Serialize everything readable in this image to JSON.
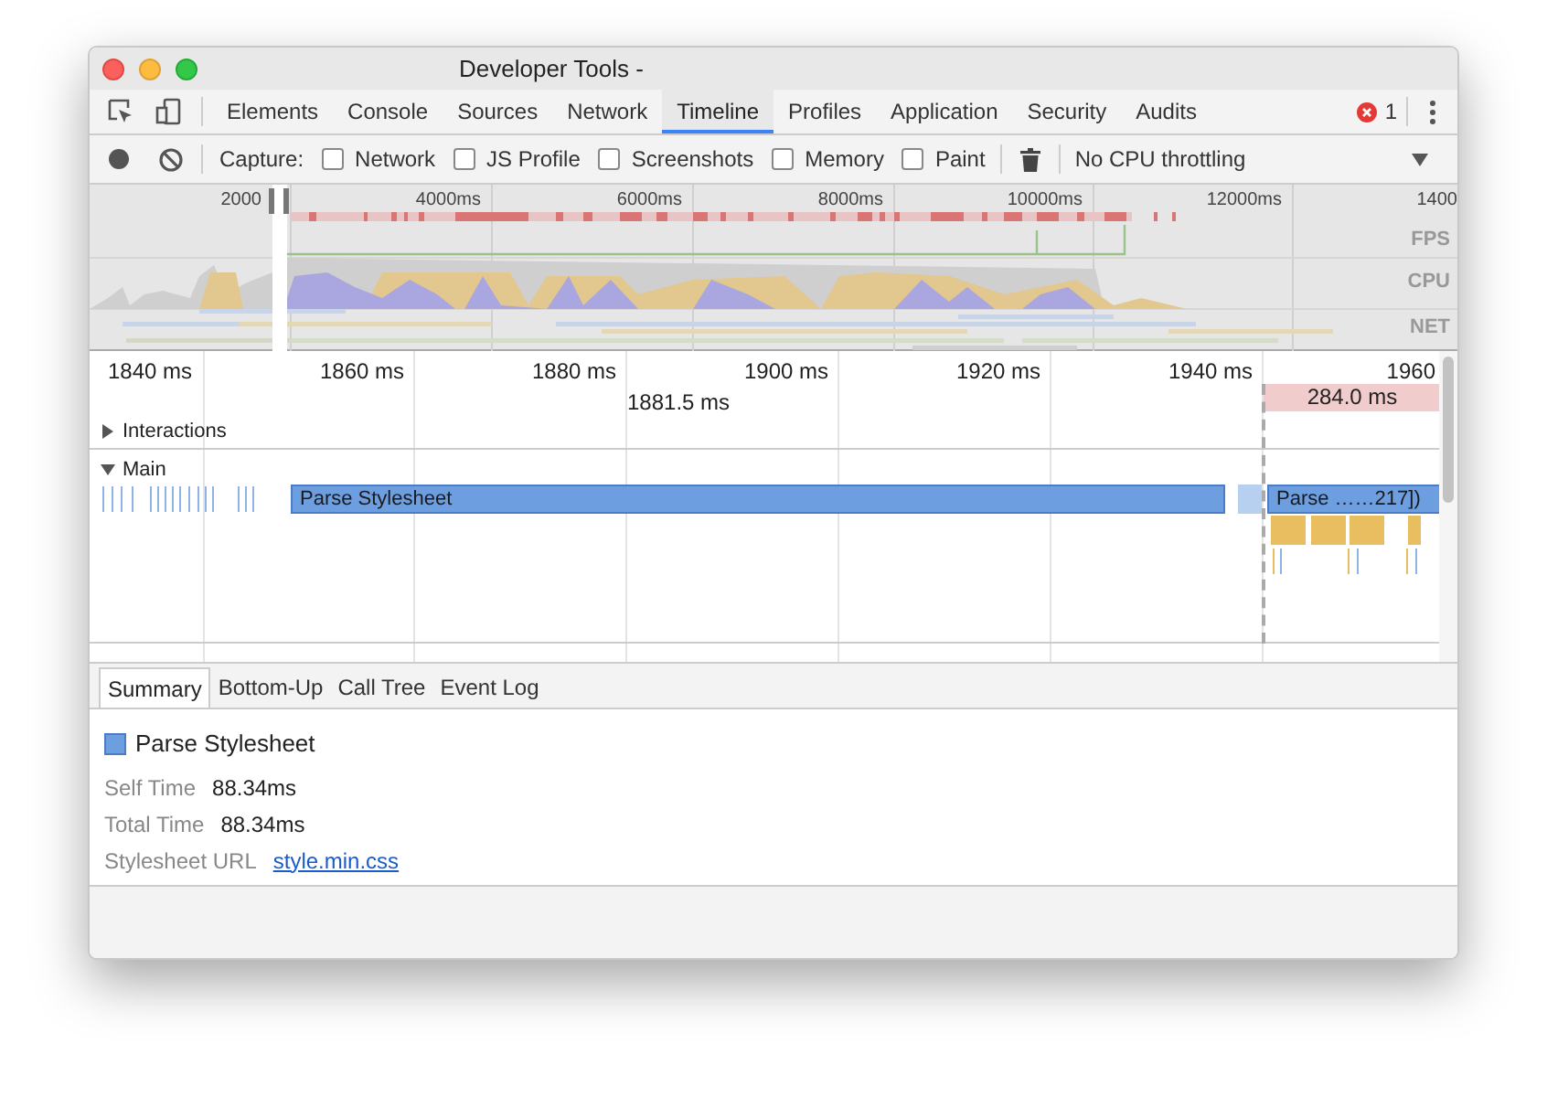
{
  "window": {
    "title": "Developer Tools -"
  },
  "main_tabs": [
    {
      "label": "Elements",
      "selected": false
    },
    {
      "label": "Console",
      "selected": false
    },
    {
      "label": "Sources",
      "selected": false
    },
    {
      "label": "Network",
      "selected": false
    },
    {
      "label": "Timeline",
      "selected": true
    },
    {
      "label": "Profiles",
      "selected": false
    },
    {
      "label": "Application",
      "selected": false
    },
    {
      "label": "Security",
      "selected": false
    },
    {
      "label": "Audits",
      "selected": false
    }
  ],
  "error_count": "1",
  "toolbar": {
    "capture_label": "Capture:",
    "checkboxes": [
      {
        "label": "Network",
        "checked": false
      },
      {
        "label": "JS Profile",
        "checked": false
      },
      {
        "label": "Screenshots",
        "checked": false
      },
      {
        "label": "Memory",
        "checked": false
      },
      {
        "label": "Paint",
        "checked": false
      }
    ],
    "throttling": "No CPU throttling"
  },
  "overview": {
    "ticks": [
      "2000",
      "4000ms",
      "6000ms",
      "8000ms",
      "10000ms",
      "12000ms",
      "1400"
    ],
    "track_labels": [
      "FPS",
      "CPU",
      "NET"
    ]
  },
  "flame_chart": {
    "ticks": [
      "1840 ms",
      "1860 ms",
      "1880 ms",
      "1900 ms",
      "1920 ms",
      "1940 ms",
      "1960"
    ],
    "selection_duration": "1881.5 ms",
    "range_duration": "284.0 ms",
    "tracks": [
      {
        "label": "Interactions",
        "expanded": false
      },
      {
        "label": "Main",
        "expanded": true
      }
    ],
    "events": [
      {
        "label": "Parse Stylesheet"
      },
      {
        "label": "Parse ……217])"
      }
    ]
  },
  "detail_tabs": [
    {
      "label": "Summary",
      "selected": true
    },
    {
      "label": "Bottom-Up",
      "selected": false
    },
    {
      "label": "Call Tree",
      "selected": false
    },
    {
      "label": "Event Log",
      "selected": false
    }
  ],
  "summary": {
    "title": "Parse Stylesheet",
    "rows": [
      {
        "label": "Self Time",
        "value": "88.34ms",
        "kind": "text"
      },
      {
        "label": "Total Time",
        "value": "88.34ms",
        "kind": "text"
      },
      {
        "label": "Stylesheet URL",
        "value": "style.min.css",
        "kind": "link"
      }
    ]
  }
}
